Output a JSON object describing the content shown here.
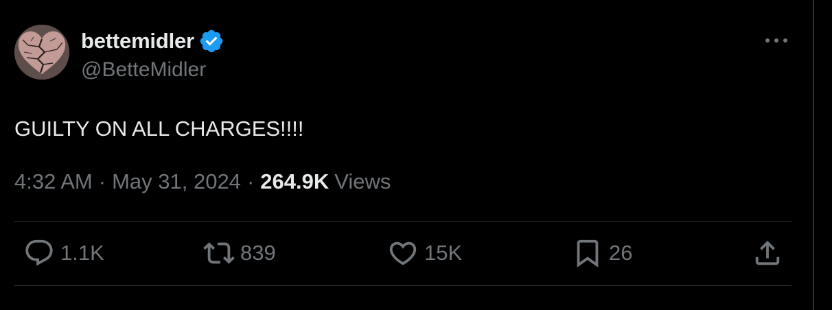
{
  "tweet": {
    "author": {
      "display_name": "bettemidler",
      "handle": "@BetteMidler",
      "verified": true,
      "avatar_icon": "cracked-heart-avatar"
    },
    "more_icon": "more-horizontal-icon",
    "text": "GUILTY ON ALL CHARGES!!!!",
    "meta": {
      "time": "4:32 AM",
      "separator": "·",
      "date": "May 31, 2024",
      "views_count": "264.9K",
      "views_label": "Views"
    },
    "actions": {
      "reply": {
        "icon": "reply-icon",
        "count": "1.1K"
      },
      "retweet": {
        "icon": "retweet-icon",
        "count": "839"
      },
      "like": {
        "icon": "heart-icon",
        "count": "15K"
      },
      "bookmark": {
        "icon": "bookmark-icon",
        "count": "26"
      },
      "share": {
        "icon": "share-icon"
      }
    }
  },
  "colors": {
    "background": "#000000",
    "primary_text": "#e7e9ea",
    "secondary_text": "#71767b",
    "divider": "#2f3336",
    "verified_badge": "#1d9bf0"
  }
}
